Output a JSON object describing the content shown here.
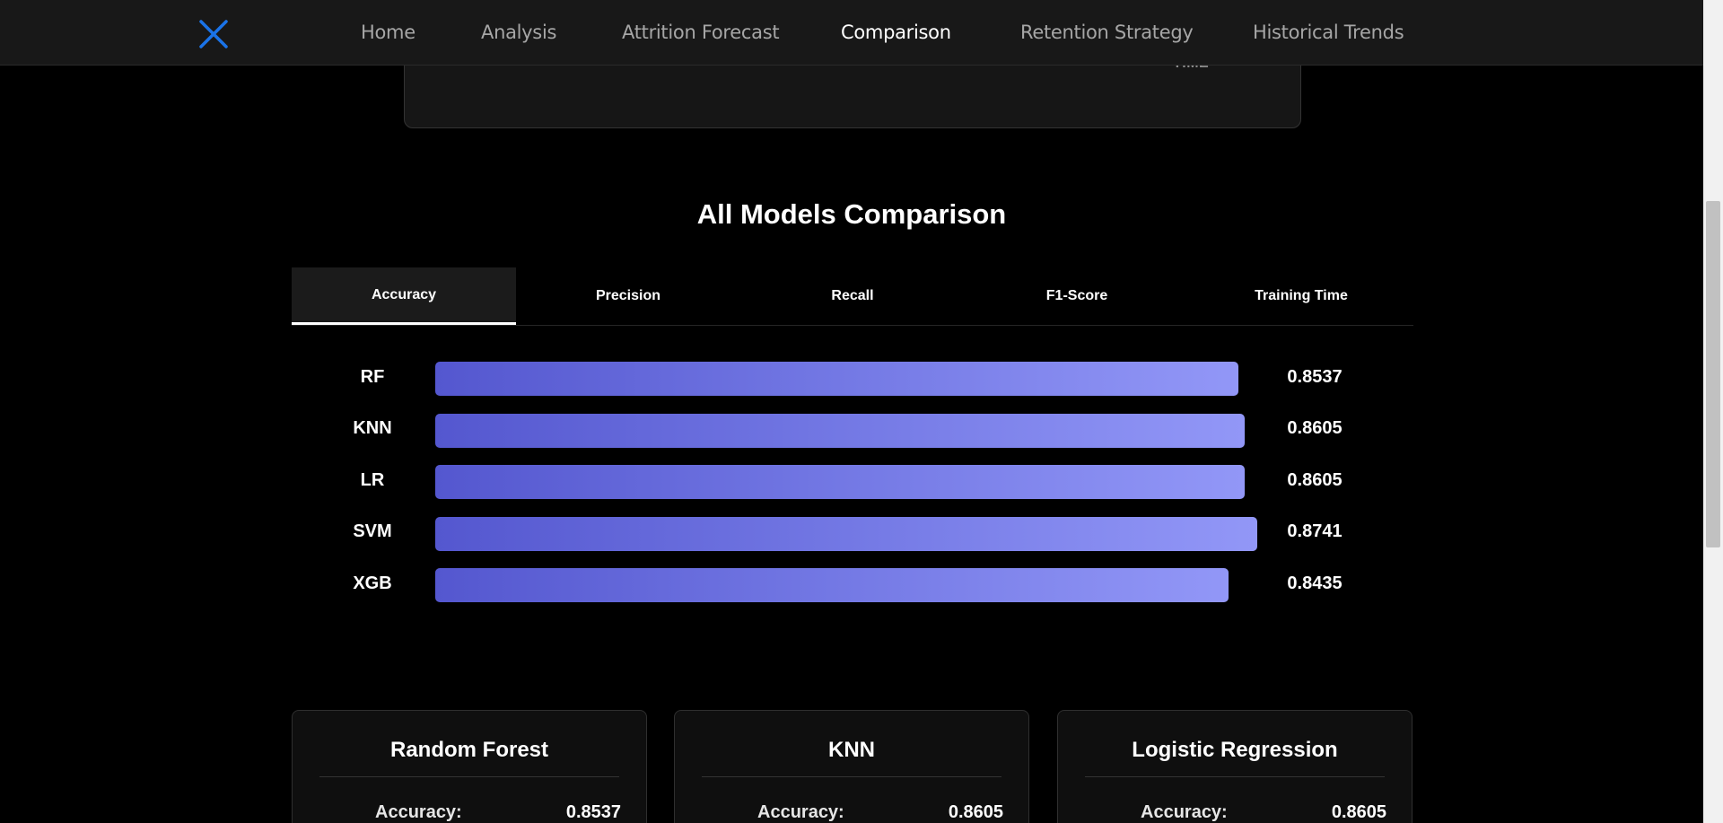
{
  "nav": {
    "logo_icon": "close-x-icon",
    "accent_color": "#1a73e8",
    "links": [
      {
        "label": "Home",
        "active": false
      },
      {
        "label": "Analysis",
        "active": false
      },
      {
        "label": "Attrition Forecast",
        "active": false
      },
      {
        "label": "Comparison",
        "active": true
      },
      {
        "label": "Retention Strategy",
        "active": false
      },
      {
        "label": "Historical Trends",
        "active": false
      }
    ]
  },
  "top_card": {
    "label_fragment": "TIME"
  },
  "comparison": {
    "title": "All Models Comparison",
    "tabs": [
      {
        "label": "Accuracy",
        "active": true
      },
      {
        "label": "Precision",
        "active": false
      },
      {
        "label": "Recall",
        "active": false
      },
      {
        "label": "F1-Score",
        "active": false
      },
      {
        "label": "Training Time",
        "active": false
      }
    ],
    "bar_colors": {
      "start": "#5457cf",
      "end": "#9297f7"
    },
    "rows": [
      {
        "model": "RF",
        "value": "0.8537",
        "score": 0.8537
      },
      {
        "model": "KNN",
        "value": "0.8605",
        "score": 0.8605
      },
      {
        "model": "LR",
        "value": "0.8605",
        "score": 0.8605
      },
      {
        "model": "SVM",
        "value": "0.8741",
        "score": 0.8741
      },
      {
        "model": "XGB",
        "value": "0.8435",
        "score": 0.8435
      }
    ]
  },
  "model_cards": [
    {
      "title": "Random Forest",
      "metric_label": "Accuracy:",
      "metric_value": "0.8537"
    },
    {
      "title": "KNN",
      "metric_label": "Accuracy:",
      "metric_value": "0.8605"
    },
    {
      "title": "Logistic Regression",
      "metric_label": "Accuracy:",
      "metric_value": "0.8605"
    }
  ]
}
